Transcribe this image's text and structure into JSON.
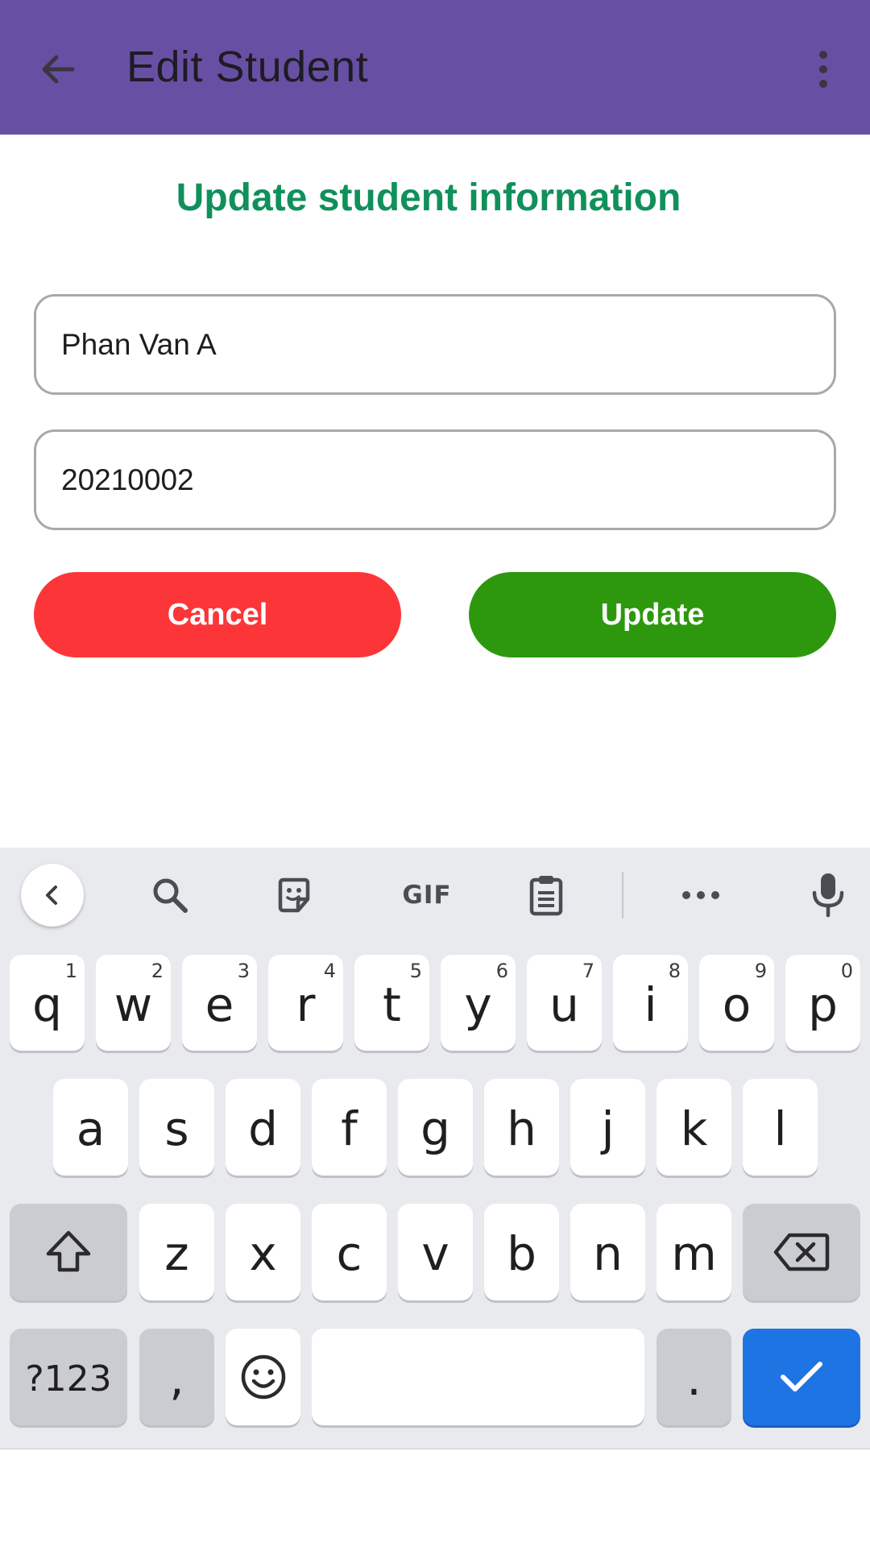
{
  "appbar": {
    "title": "Edit Student",
    "back_icon": "arrow-back-icon",
    "more_icon": "more-vert-icon",
    "background": "#6750A4"
  },
  "form": {
    "heading": "Update student information",
    "name_value": "Phan Van A",
    "id_value": "20210002",
    "cancel_label": "Cancel",
    "update_label": "Update",
    "colors": {
      "heading": "#10905A",
      "cancel": "#FC3638",
      "update": "#2D980E"
    }
  },
  "keyboard": {
    "toolbar": {
      "gif_label": "GIF",
      "icons": [
        "chevron-left-icon",
        "search-icon",
        "sticker-icon",
        "gif-icon",
        "clipboard-icon",
        "more-horiz-icon",
        "mic-icon"
      ]
    },
    "row1": [
      {
        "k": "q",
        "h": "1"
      },
      {
        "k": "w",
        "h": "2"
      },
      {
        "k": "e",
        "h": "3"
      },
      {
        "k": "r",
        "h": "4"
      },
      {
        "k": "t",
        "h": "5"
      },
      {
        "k": "y",
        "h": "6"
      },
      {
        "k": "u",
        "h": "7"
      },
      {
        "k": "i",
        "h": "8"
      },
      {
        "k": "o",
        "h": "9"
      },
      {
        "k": "p",
        "h": "0"
      }
    ],
    "row2": [
      "a",
      "s",
      "d",
      "f",
      "g",
      "h",
      "j",
      "k",
      "l"
    ],
    "row3": [
      "z",
      "x",
      "c",
      "v",
      "b",
      "n",
      "m"
    ],
    "symbols_label": "?123",
    "comma_label": ",",
    "period_label": ".",
    "enter_color": "#1F74E4"
  }
}
